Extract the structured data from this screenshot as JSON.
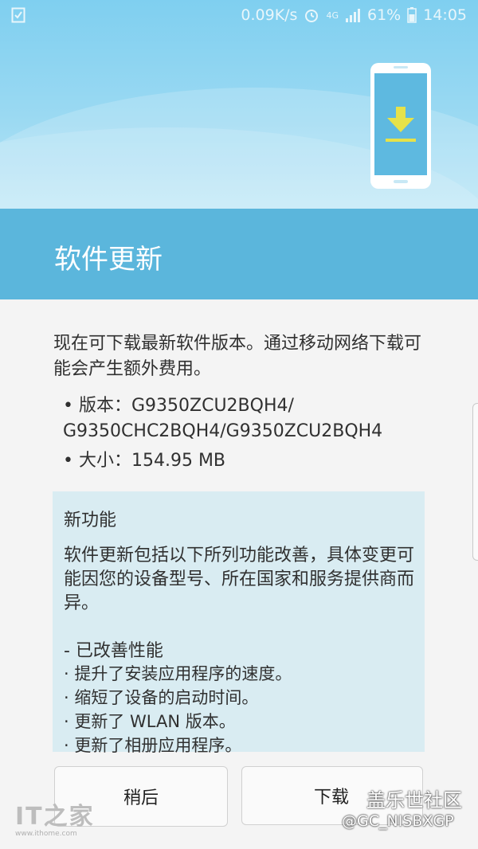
{
  "status": {
    "speed": "0.09K/s",
    "network": "4G",
    "battery": "61%",
    "time": "14:05",
    "icons": [
      "checkbox-icon",
      "alarm-icon",
      "lte-icon",
      "signal-icon",
      "battery-icon"
    ]
  },
  "header": {
    "title": "软件更新"
  },
  "intro": "现在可下载最新软件版本。通过移动网络下载可能会产生额外费用。",
  "version_line_1": "• 版本：G9350ZCU2BQH4/",
  "version_line_2": "G9350CHC2BQH4/G9350ZCU2BQH4",
  "size_line": "• 大小：154.95 MB",
  "features": {
    "heading": "新功能",
    "description": "软件更新包括以下所列功能改善，具体变更可能因您的设备型号、所在国家和服务提供商而异。",
    "section": "- 已改善性能",
    "items": [
      "· 提升了安装应用程序的速度。",
      "· 缩短了设备的启动时间。",
      "· 更新了 WLAN 版本。",
      "· 更新了相册应用程序。"
    ]
  },
  "buttons": {
    "later": "稍后",
    "download": "下载"
  },
  "watermarks": {
    "left_big": "IT之家",
    "left_small": "www.ithome.com",
    "right_1": "盖乐世社区",
    "right_2": "@GC_NISBXGP"
  },
  "colors": {
    "hero_top": "#7fcff0",
    "title_bar": "#5bb6dc",
    "features_bg": "#d9ecf2",
    "download_icon": "#e6e24a"
  }
}
